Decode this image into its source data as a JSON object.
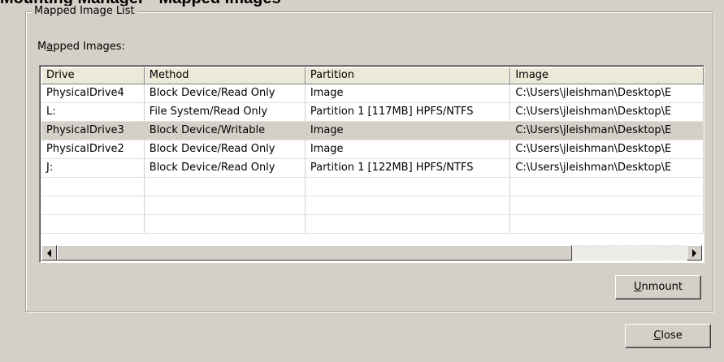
{
  "window": {
    "title": "Mounting Manager - Mapped Images"
  },
  "group": {
    "title": "Mapped Image List"
  },
  "list": {
    "label_pre": "M",
    "label_accel": "a",
    "label_post": "pped Images:",
    "columns": [
      "Drive",
      "Method",
      "Partition",
      "Image"
    ],
    "rows": [
      {
        "drive": "PhysicalDrive4",
        "method": "Block Device/Read Only",
        "partition": "Image",
        "image": "C:\\Users\\jleishman\\Desktop\\E"
      },
      {
        "drive": "L:",
        "method": "File System/Read Only",
        "partition": "Partition 1 [117MB] HPFS/NTFS",
        "image": "C:\\Users\\jleishman\\Desktop\\E"
      },
      {
        "drive": "PhysicalDrive3",
        "method": "Block Device/Writable",
        "partition": "Image",
        "image": "C:\\Users\\jleishman\\Desktop\\E"
      },
      {
        "drive": "PhysicalDrive2",
        "method": "Block Device/Read Only",
        "partition": "Image",
        "image": "C:\\Users\\jleishman\\Desktop\\E"
      },
      {
        "drive": "J:",
        "method": "Block Device/Read Only",
        "partition": "Partition 1 [122MB] HPFS/NTFS",
        "image": "C:\\Users\\jleishman\\Desktop\\E"
      },
      {
        "drive": "",
        "method": "",
        "partition": "",
        "image": ""
      },
      {
        "drive": "",
        "method": "",
        "partition": "",
        "image": ""
      },
      {
        "drive": "",
        "method": "",
        "partition": "",
        "image": ""
      }
    ],
    "selected_row": 2
  },
  "buttons": {
    "unmount_accel": "U",
    "unmount_rest": "nmount",
    "close_accel": "C",
    "close_rest": "lose"
  },
  "icons": {
    "scroll_left": "left-arrow-icon",
    "scroll_right": "right-arrow-icon"
  },
  "colors": {
    "dialog_bg": "#d4d0c8",
    "selected_row": "#d4d0c8",
    "list_bg": "#ffffff"
  }
}
